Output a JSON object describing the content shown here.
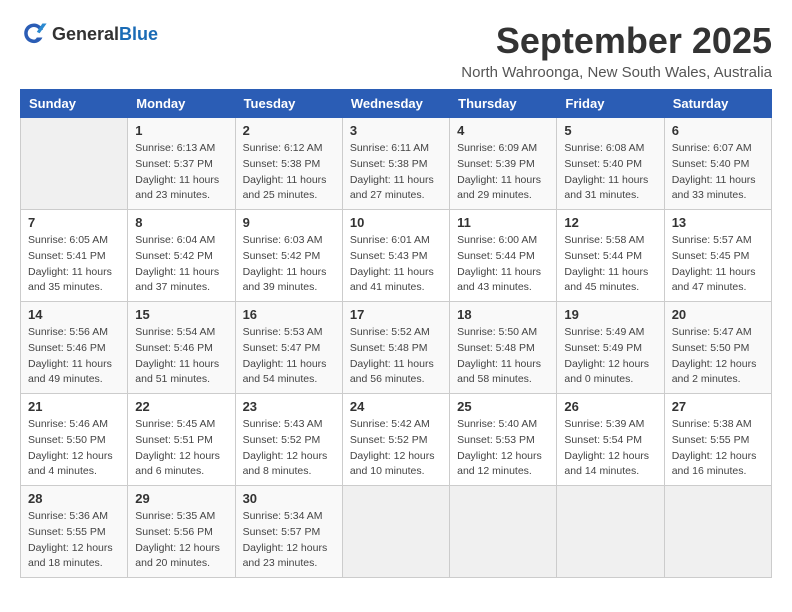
{
  "header": {
    "logo_general": "General",
    "logo_blue": "Blue",
    "month_title": "September 2025",
    "location": "North Wahroonga, New South Wales, Australia"
  },
  "days_of_week": [
    "Sunday",
    "Monday",
    "Tuesday",
    "Wednesday",
    "Thursday",
    "Friday",
    "Saturday"
  ],
  "weeks": [
    [
      {
        "day": "",
        "info": ""
      },
      {
        "day": "1",
        "info": "Sunrise: 6:13 AM\nSunset: 5:37 PM\nDaylight: 11 hours\nand 23 minutes."
      },
      {
        "day": "2",
        "info": "Sunrise: 6:12 AM\nSunset: 5:38 PM\nDaylight: 11 hours\nand 25 minutes."
      },
      {
        "day": "3",
        "info": "Sunrise: 6:11 AM\nSunset: 5:38 PM\nDaylight: 11 hours\nand 27 minutes."
      },
      {
        "day": "4",
        "info": "Sunrise: 6:09 AM\nSunset: 5:39 PM\nDaylight: 11 hours\nand 29 minutes."
      },
      {
        "day": "5",
        "info": "Sunrise: 6:08 AM\nSunset: 5:40 PM\nDaylight: 11 hours\nand 31 minutes."
      },
      {
        "day": "6",
        "info": "Sunrise: 6:07 AM\nSunset: 5:40 PM\nDaylight: 11 hours\nand 33 minutes."
      }
    ],
    [
      {
        "day": "7",
        "info": "Sunrise: 6:05 AM\nSunset: 5:41 PM\nDaylight: 11 hours\nand 35 minutes."
      },
      {
        "day": "8",
        "info": "Sunrise: 6:04 AM\nSunset: 5:42 PM\nDaylight: 11 hours\nand 37 minutes."
      },
      {
        "day": "9",
        "info": "Sunrise: 6:03 AM\nSunset: 5:42 PM\nDaylight: 11 hours\nand 39 minutes."
      },
      {
        "day": "10",
        "info": "Sunrise: 6:01 AM\nSunset: 5:43 PM\nDaylight: 11 hours\nand 41 minutes."
      },
      {
        "day": "11",
        "info": "Sunrise: 6:00 AM\nSunset: 5:44 PM\nDaylight: 11 hours\nand 43 minutes."
      },
      {
        "day": "12",
        "info": "Sunrise: 5:58 AM\nSunset: 5:44 PM\nDaylight: 11 hours\nand 45 minutes."
      },
      {
        "day": "13",
        "info": "Sunrise: 5:57 AM\nSunset: 5:45 PM\nDaylight: 11 hours\nand 47 minutes."
      }
    ],
    [
      {
        "day": "14",
        "info": "Sunrise: 5:56 AM\nSunset: 5:46 PM\nDaylight: 11 hours\nand 49 minutes."
      },
      {
        "day": "15",
        "info": "Sunrise: 5:54 AM\nSunset: 5:46 PM\nDaylight: 11 hours\nand 51 minutes."
      },
      {
        "day": "16",
        "info": "Sunrise: 5:53 AM\nSunset: 5:47 PM\nDaylight: 11 hours\nand 54 minutes."
      },
      {
        "day": "17",
        "info": "Sunrise: 5:52 AM\nSunset: 5:48 PM\nDaylight: 11 hours\nand 56 minutes."
      },
      {
        "day": "18",
        "info": "Sunrise: 5:50 AM\nSunset: 5:48 PM\nDaylight: 11 hours\nand 58 minutes."
      },
      {
        "day": "19",
        "info": "Sunrise: 5:49 AM\nSunset: 5:49 PM\nDaylight: 12 hours\nand 0 minutes."
      },
      {
        "day": "20",
        "info": "Sunrise: 5:47 AM\nSunset: 5:50 PM\nDaylight: 12 hours\nand 2 minutes."
      }
    ],
    [
      {
        "day": "21",
        "info": "Sunrise: 5:46 AM\nSunset: 5:50 PM\nDaylight: 12 hours\nand 4 minutes."
      },
      {
        "day": "22",
        "info": "Sunrise: 5:45 AM\nSunset: 5:51 PM\nDaylight: 12 hours\nand 6 minutes."
      },
      {
        "day": "23",
        "info": "Sunrise: 5:43 AM\nSunset: 5:52 PM\nDaylight: 12 hours\nand 8 minutes."
      },
      {
        "day": "24",
        "info": "Sunrise: 5:42 AM\nSunset: 5:52 PM\nDaylight: 12 hours\nand 10 minutes."
      },
      {
        "day": "25",
        "info": "Sunrise: 5:40 AM\nSunset: 5:53 PM\nDaylight: 12 hours\nand 12 minutes."
      },
      {
        "day": "26",
        "info": "Sunrise: 5:39 AM\nSunset: 5:54 PM\nDaylight: 12 hours\nand 14 minutes."
      },
      {
        "day": "27",
        "info": "Sunrise: 5:38 AM\nSunset: 5:55 PM\nDaylight: 12 hours\nand 16 minutes."
      }
    ],
    [
      {
        "day": "28",
        "info": "Sunrise: 5:36 AM\nSunset: 5:55 PM\nDaylight: 12 hours\nand 18 minutes."
      },
      {
        "day": "29",
        "info": "Sunrise: 5:35 AM\nSunset: 5:56 PM\nDaylight: 12 hours\nand 20 minutes."
      },
      {
        "day": "30",
        "info": "Sunrise: 5:34 AM\nSunset: 5:57 PM\nDaylight: 12 hours\nand 23 minutes."
      },
      {
        "day": "",
        "info": ""
      },
      {
        "day": "",
        "info": ""
      },
      {
        "day": "",
        "info": ""
      },
      {
        "day": "",
        "info": ""
      }
    ]
  ]
}
